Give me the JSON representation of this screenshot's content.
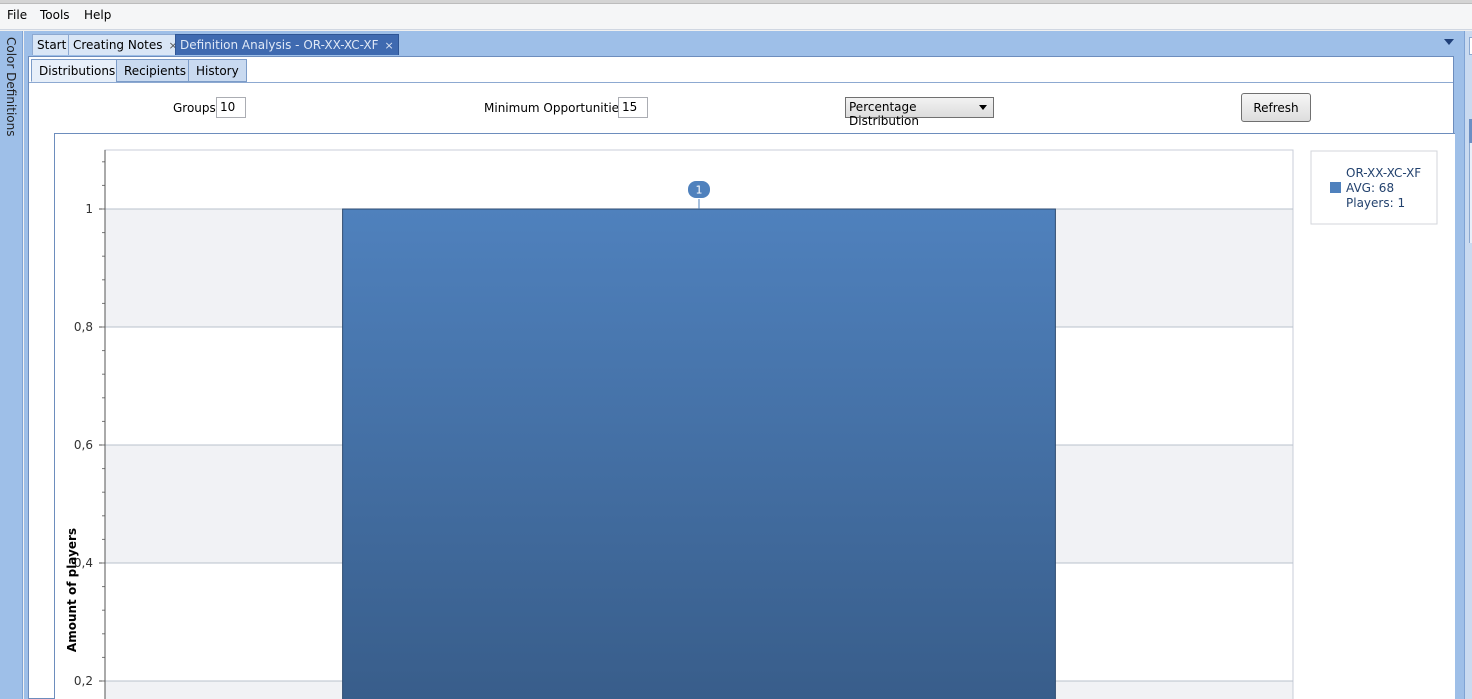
{
  "menu": [
    "File",
    "Tools",
    "Help"
  ],
  "sidebar_label": "Color Definitions",
  "doc_tabs": [
    {
      "label": "Start",
      "closable": false,
      "active": false
    },
    {
      "label": "Creating Notes",
      "closable": true,
      "active": false
    },
    {
      "label": "Definition Analysis - OR-XX-XC-XF",
      "closable": true,
      "active": true
    }
  ],
  "close_glyph": "×",
  "sub_tabs": [
    {
      "label": "Distributions",
      "active": true
    },
    {
      "label": "Recipients",
      "active": false
    },
    {
      "label": "History",
      "active": false
    }
  ],
  "controls": {
    "groups_label": "Groups",
    "groups_value": "10",
    "min_opps_label": "Minimum Opportunities",
    "min_opps_value": "15",
    "distribution_selected": "Percentage Distribution",
    "refresh_label": "Refresh"
  },
  "colors": {
    "bar_top": "#4f81bd",
    "bar_bottom": "#385d8a",
    "band": "#f1f2f5",
    "accent": "#3f6ab0"
  },
  "chart_data": {
    "type": "bar",
    "categories": [
      ""
    ],
    "series": [
      {
        "name": "OR-XX-XC-XF",
        "values": [
          1
        ],
        "data_labels": [
          "1"
        ]
      }
    ],
    "ylabel": "Amount of players",
    "yticks": [
      "1",
      "0,8",
      "0,6",
      "0,4",
      "0,2"
    ],
    "ytick_values": [
      1,
      0.8,
      0.6,
      0.4,
      0.2
    ],
    "ylim": [
      0,
      1.1
    ],
    "legend": {
      "position": "top-right",
      "lines": [
        "OR-XX-XC-XF",
        "AVG: 68",
        "Players: 1"
      ]
    },
    "grid": true
  }
}
